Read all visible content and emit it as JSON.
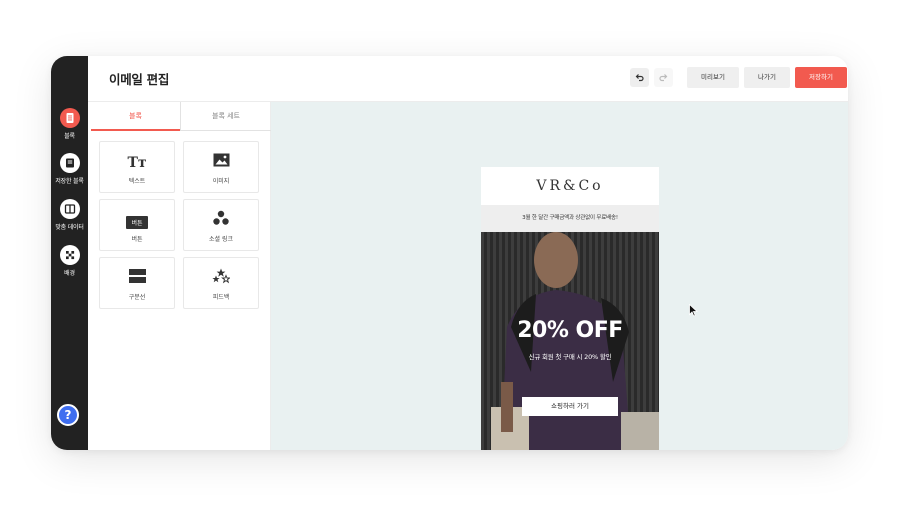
{
  "app": {
    "title": "이메일 편집"
  },
  "rail": {
    "items": [
      {
        "label": "블록",
        "icon": "document-icon",
        "color": "#f25a4f"
      },
      {
        "label": "저장한 블록",
        "icon": "saved-block-icon",
        "color": "#ffffff"
      },
      {
        "label": "맞춤 데이터",
        "icon": "custom-data-icon",
        "color": "#ffffff"
      },
      {
        "label": "배경",
        "icon": "checker-background-icon",
        "color": "#ffffff"
      }
    ],
    "help": "?"
  },
  "toolbar": {
    "undo_icon": "undo-icon",
    "redo_icon": "redo-icon",
    "preview": "미리보기",
    "exit": "나가기",
    "save": "저장하기"
  },
  "panel": {
    "tabs": [
      {
        "label": "블록"
      },
      {
        "label": "블록 세트"
      }
    ],
    "tiles": [
      {
        "label": "텍스트",
        "icon": "text-icon",
        "glyph": "Tт"
      },
      {
        "label": "이미지",
        "icon": "image-icon"
      },
      {
        "label": "버튼",
        "icon": "button-icon",
        "glyph": "버튼"
      },
      {
        "label": "소셜 링크",
        "icon": "social-links-icon"
      },
      {
        "label": "구분선",
        "icon": "divider-icon"
      },
      {
        "label": "피드백",
        "icon": "feedback-stars-icon"
      }
    ]
  },
  "email": {
    "logo": "VR&Co",
    "notice": "3월 한 달간 구매금액과 상관없이 무료배송!",
    "headline": "20% OFF",
    "subline": "신규 회원 첫 구매 시 20% 할인",
    "cta": "쇼핑하러 가기"
  },
  "colors": {
    "accent": "#f25a4f",
    "rail": "#222222",
    "canvas": "#e9f1f1",
    "help": "#3f6ef0"
  }
}
